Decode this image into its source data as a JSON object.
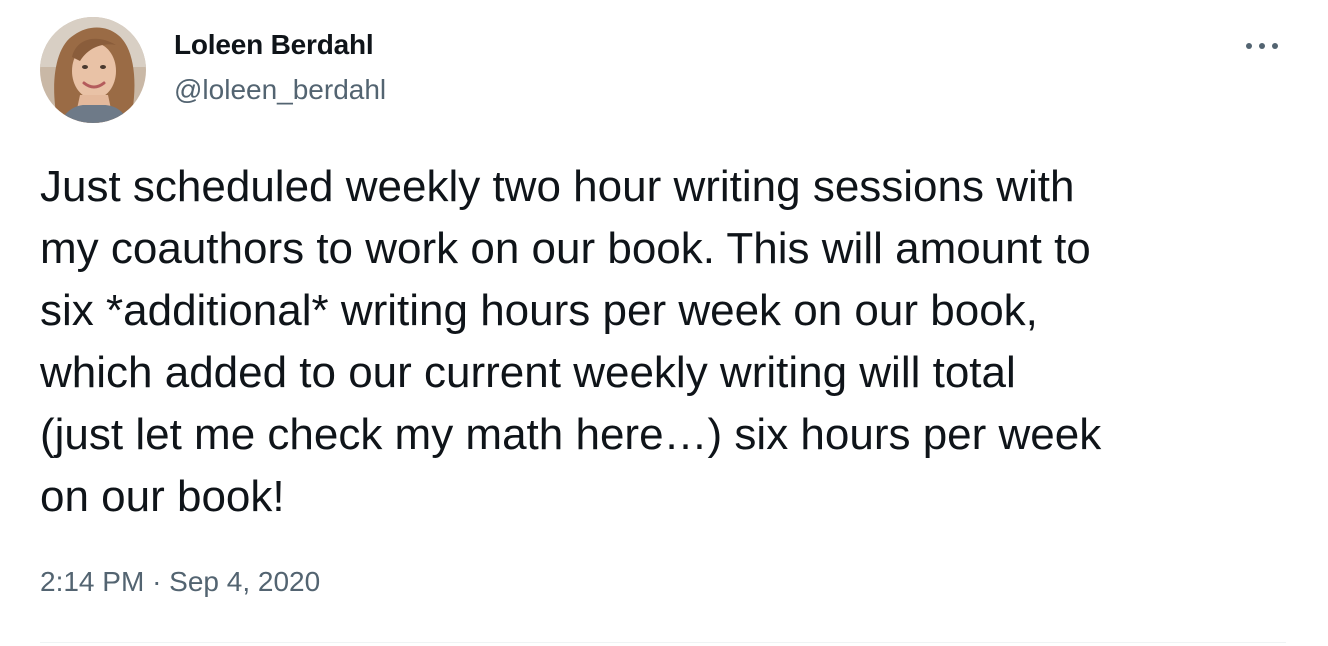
{
  "tweet": {
    "author": {
      "display_name": "Loleen Berdahl",
      "handle": "@loleen_berdahl",
      "avatar_icon": "profile-photo"
    },
    "more_icon": "ellipsis-icon",
    "text_lines": [
      "Just scheduled weekly two hour writing sessions with",
      "my coauthors to work on our book. This will amount to",
      "six *additional* writing hours per week on our book,",
      "which added to our current weekly writing will total",
      "(just let me check my math here…) six hours per week",
      "on our book!"
    ],
    "time": "2:14 PM",
    "separator": "·",
    "date": "Sep 4, 2020"
  },
  "colors": {
    "text_primary": "#0f1419",
    "text_secondary": "#536471",
    "divider": "#eff3f4"
  }
}
